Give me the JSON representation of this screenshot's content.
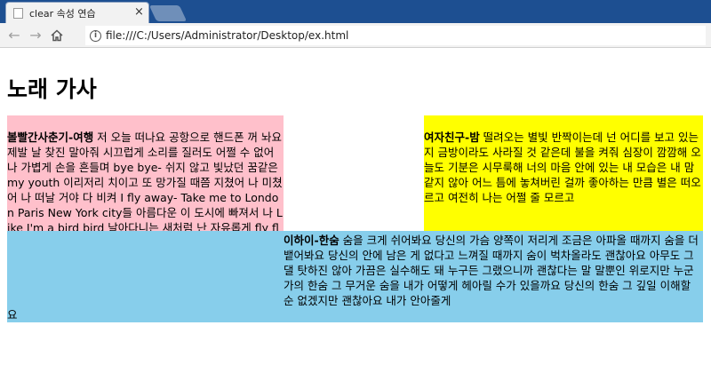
{
  "browser": {
    "tab_title": "clear 속성 연습",
    "tab_close": "×",
    "url": "file:///C:/Users/Administrator/Desktop/ex.html",
    "back_icon": "←",
    "forward_icon": "→",
    "info_icon": "i"
  },
  "page": {
    "title": "노래 가사",
    "songs": [
      {
        "heading": "볼빨간사춘기-여행",
        "lyrics": " 저 오늘 떠나요 공항으로 핸드폰 꺼 놔요 제발 날 찾진 말아줘 시끄럽게 소리를 질러도 어쩔 수 없어 나 가볍게 손을 흔들며 bye bye- 쉬지 않고 빛났던 꿈같은 my youth 이리저리 치이고 또 망가질 때쯤 지쳤어 나 미쳤어 나 떠날 거야 다 비켜 I fly away- Take me to London Paris New York city들 아름다운 이 도시에 빠져서 나 Like I'm a bird bird 날아다니는 새처럼 난 자유롭게 fly fly 나 숨을 셔 Take me to new world anywhere 어디든 답답한 이 곳을 벗어 나기만 하면 Shining light light 빛나는 my youth 자유롭게 fly fly 나 숨을 셔"
      },
      {
        "heading": "여자친구-밤",
        "lyrics": " 떨려오는 별빛 반짝이는데 넌 어디를 보고 있는지 금방이라도 사라질 것 같은데 불을 켜줘 심장이 깜깜해 오늘도 기분은 시무룩해 너의 마음 안에 있는 내 모습은 내 맘 같지 않아 어느 틈에 놓쳐버린 걸까 좋아하는 만큼 별은 떠오르고 여전히 나는 어쩔 줄 모르고"
      },
      {
        "heading": "이하이-한숨",
        "lyrics": " 숨을 크게 쉬어봐요 당신의 가슴 양쪽이 저리게 조금은 아파올 때까지 숨을 더 뱉어봐요 당신의 안에 남은 게 없다고 느껴질 때까지 숨이 벅차올라도 괜찮아요 아무도 그댈 탓하진 않아 가끔은 실수해도 돼 누구든 그랬으니까 괜찮다는 말 말뿐인 위로지만 누군가의 한숨 그 무거운 숨을 내가 어떻게 헤아릴 수가 있을까요 당신의 한숨 그 깊일 이해할 순 없겠지만 괜찮아요 내가 안아줄게",
        "tail": "요"
      }
    ],
    "colors": {
      "pink": "#ffc0cb",
      "yellow": "#ffff00",
      "blue": "#87ceeb"
    }
  }
}
